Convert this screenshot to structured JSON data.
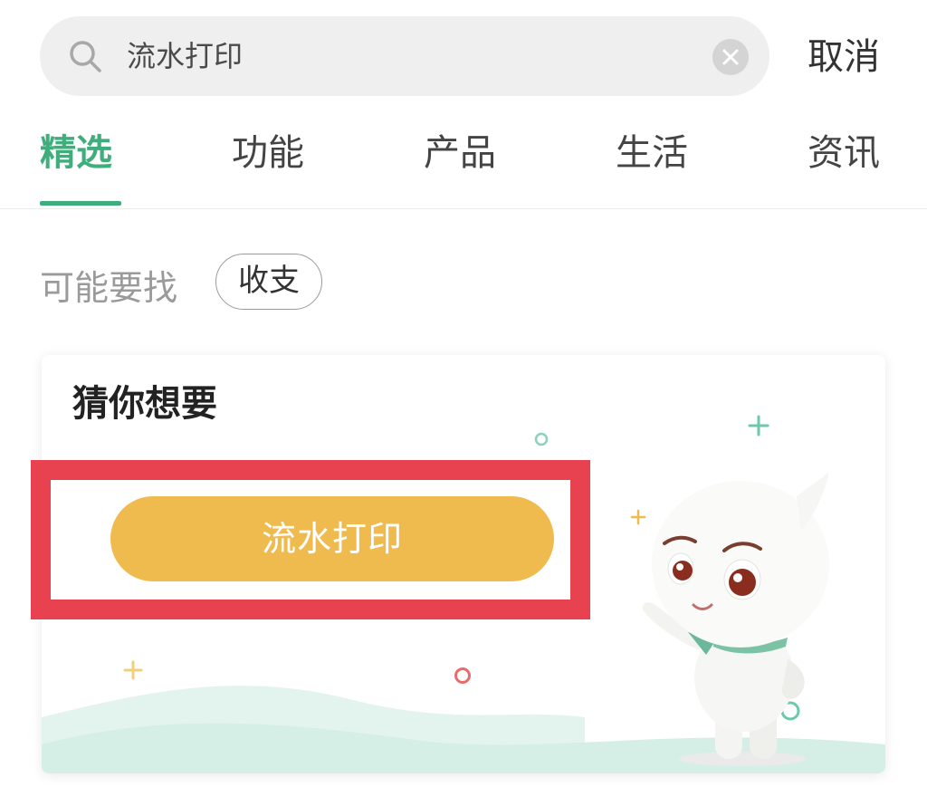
{
  "search": {
    "query": "流水打印",
    "cancel_label": "取消"
  },
  "tabs": [
    {
      "label": "精选",
      "active": true
    },
    {
      "label": "功能",
      "active": false
    },
    {
      "label": "产品",
      "active": false
    },
    {
      "label": "生活",
      "active": false
    },
    {
      "label": "资讯",
      "active": false
    }
  ],
  "suggest": {
    "label": "可能要找",
    "chip": "收支"
  },
  "card": {
    "title": "猜你想要",
    "button_label": "流水打印"
  },
  "colors": {
    "accent_green": "#3fae7c",
    "button_yellow": "#efbb4f",
    "highlight_red": "#e8414f"
  },
  "icons": {
    "search": "search-icon",
    "clear": "clear-icon",
    "mascot": "mascot-illustration"
  }
}
